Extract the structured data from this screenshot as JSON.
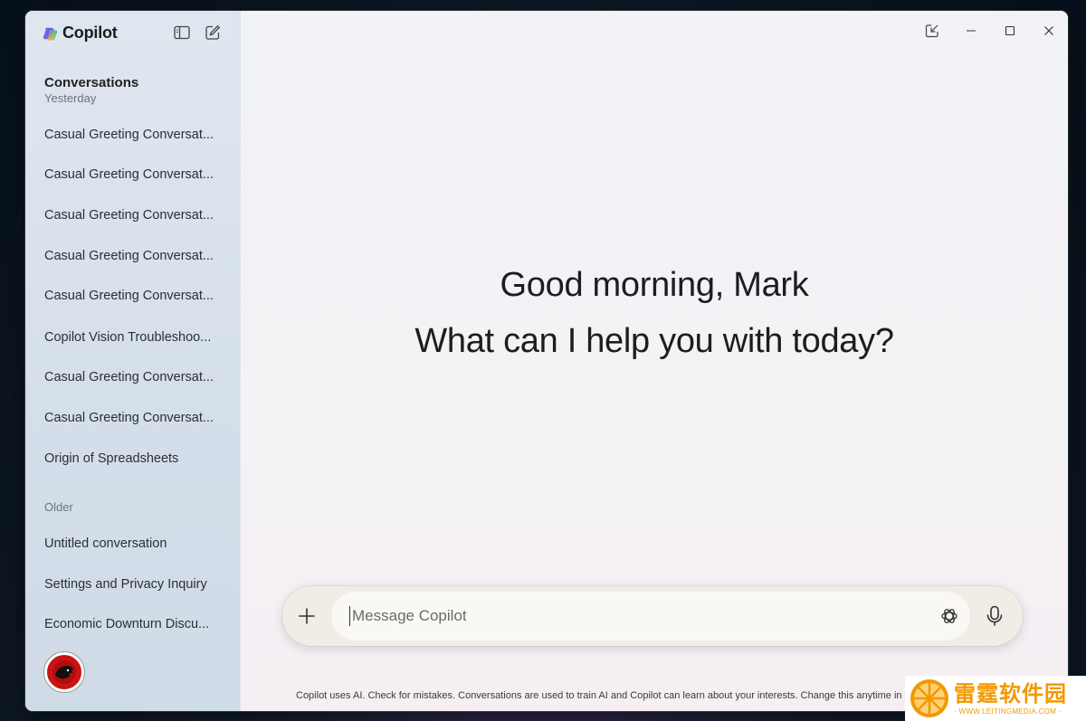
{
  "app": {
    "name": "Copilot"
  },
  "sidebar": {
    "heading": "Conversations",
    "sections": [
      {
        "label": "Yesterday",
        "items": [
          "Casual Greeting Conversat...",
          "Casual Greeting Conversat...",
          "Casual Greeting Conversat...",
          "Casual Greeting Conversat...",
          "Casual Greeting Conversat...",
          "Copilot Vision Troubleshoo...",
          "Casual Greeting Conversat...",
          "Casual Greeting Conversat...",
          "Origin of Spreadsheets"
        ]
      },
      {
        "label": "Older",
        "items": [
          "Untitled conversation",
          "Settings and Privacy Inquiry",
          "Economic Downturn Discu..."
        ]
      }
    ]
  },
  "main": {
    "greeting_line1": "Good morning, Mark",
    "greeting_line2": "What can I help you with today?"
  },
  "composer": {
    "placeholder": "Message Copilot"
  },
  "disclaimer": "Copilot uses AI. Check for mistakes. Conversations are used to train AI and Copilot can learn about your interests. Change this anytime in you",
  "watermark": {
    "text": "雷霆软件园",
    "url": "· WWW.LEITINGMEDIA.COM ·"
  },
  "colors": {
    "accent_watermark": "#f39800",
    "avatar": "#c91414"
  }
}
